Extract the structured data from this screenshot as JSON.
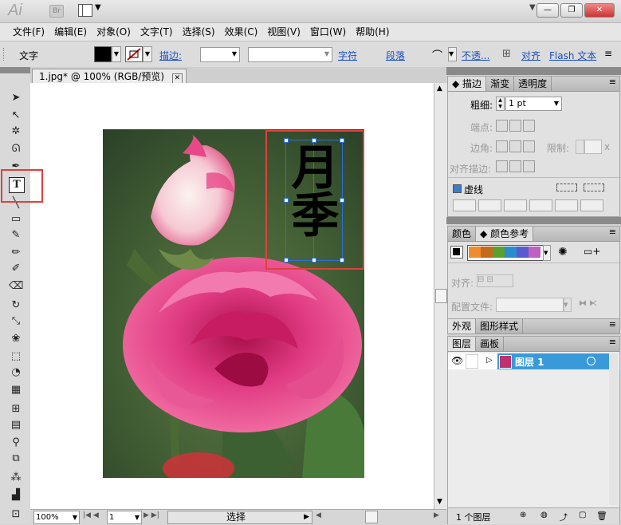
{
  "app": {
    "logo": "Ai",
    "bridge": "Br"
  },
  "menu": [
    "文件(F)",
    "编辑(E)",
    "对象(O)",
    "文字(T)",
    "选择(S)",
    "效果(C)",
    "视图(V)",
    "窗口(W)",
    "帮助(H)"
  ],
  "control": {
    "tool_label": "文字",
    "stroke_label": "描边:",
    "char_label": "字符",
    "para_label": "段落",
    "opacity_label": "不透...",
    "align_label": "对齐",
    "flash_label": "Flash 文本"
  },
  "document": {
    "tab_title": "1.jpg* @ 100% (RGB/预览)",
    "text_content": "月季"
  },
  "status": {
    "zoom": "100%",
    "page": "1",
    "mode": "选择"
  },
  "stroke_panel": {
    "tabs": [
      "描边",
      "渐变",
      "透明度"
    ],
    "weight_label": "粗细:",
    "weight_value": "1 pt",
    "cap_label": "端点:",
    "corner_label": "边角:",
    "limit_label": "限制:",
    "limit_suffix": "x",
    "align_label": "对齐描边:",
    "dashed_label": "虚线"
  },
  "color_panel": {
    "tabs": [
      "颜色",
      "颜色参考"
    ],
    "swatches": [
      "#f08c2c",
      "#c46a1a",
      "#5aa02c",
      "#2c8cd0",
      "#5a5ad0",
      "#c060c0"
    ],
    "align_label": "对齐:",
    "config_label": "配置文件:"
  },
  "appearance_panel": {
    "tabs": [
      "外观",
      "图形样式"
    ]
  },
  "layers_panel": {
    "tabs": [
      "图层",
      "画板"
    ],
    "layer_name": "图层 1",
    "footer": "1 个图层"
  },
  "colors": {
    "highlight_red": "#e0403a",
    "selection_blue": "#2e6fd8",
    "layer_row": "#3a9ad9"
  }
}
